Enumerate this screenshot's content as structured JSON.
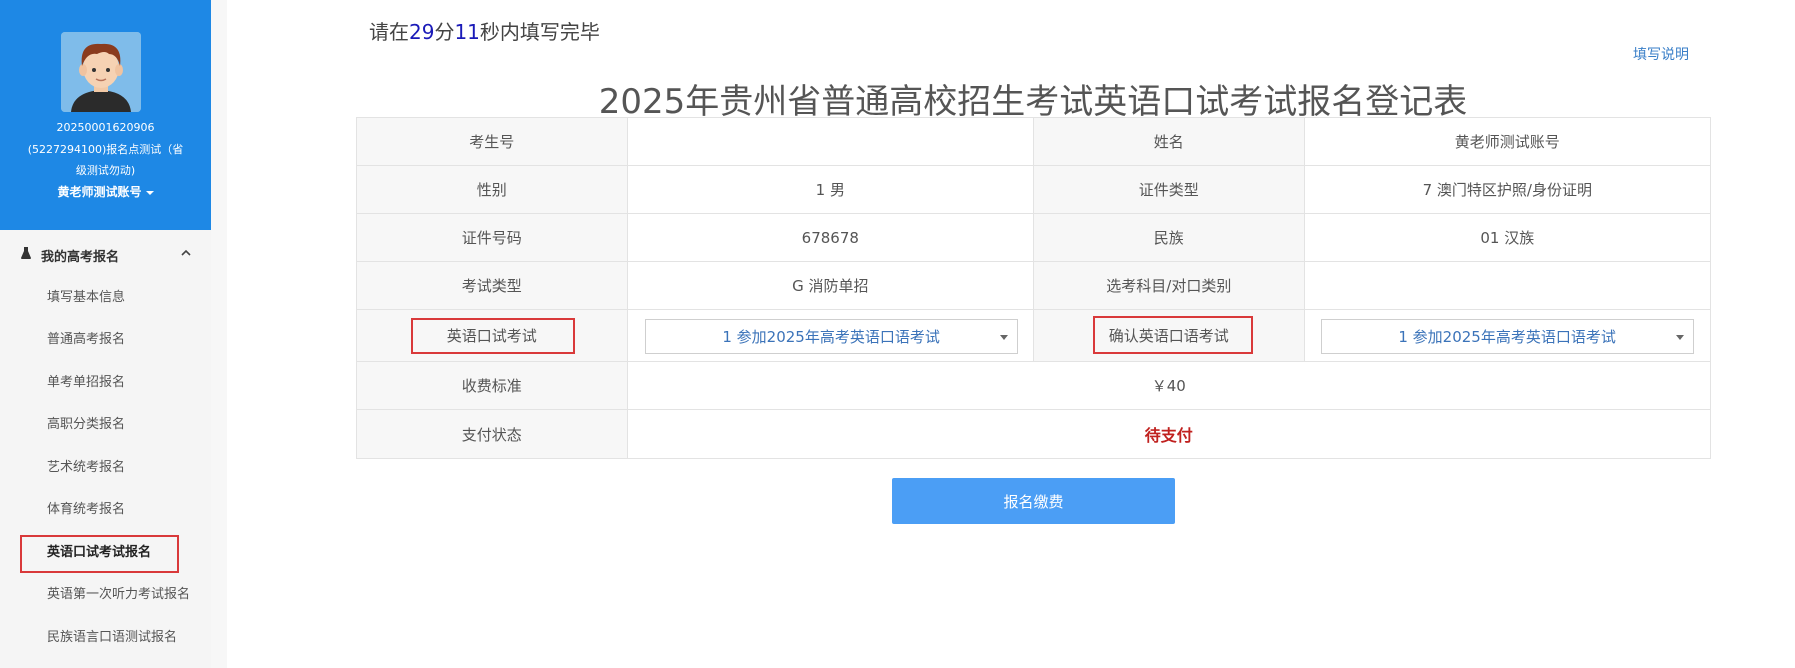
{
  "profile": {
    "id_line": "20250001620906",
    "site_line1": "(5227294100)报名点测试（省",
    "site_line2": "级测试勿动)",
    "user_name": "黄老师测试账号"
  },
  "sidebar": {
    "section_title": "我的高考报名",
    "items": [
      {
        "label": "填写基本信息"
      },
      {
        "label": "普通高考报名"
      },
      {
        "label": "单考单招报名"
      },
      {
        "label": "高职分类报名"
      },
      {
        "label": "艺术统考报名"
      },
      {
        "label": "体育统考报名"
      },
      {
        "label": "英语口试考试报名"
      },
      {
        "label": "英语第一次听力考试报名"
      },
      {
        "label": "民族语言口语测试报名"
      }
    ],
    "active_index": 6
  },
  "timer": {
    "prefix": "请在",
    "minutes": "29",
    "minutes_unit": "分",
    "seconds": "11",
    "suffix": "秒内填写完毕"
  },
  "help_link": "填写说明",
  "form": {
    "title": "2025年贵州省普通高校招生考试英语口试考试报名登记表",
    "rows": {
      "exam_no": {
        "label": "考生号",
        "value": ""
      },
      "name": {
        "label": "姓名",
        "value": "黄老师测试账号"
      },
      "gender": {
        "label": "性别",
        "value": "1 男"
      },
      "id_type": {
        "label": "证件类型",
        "value": "7 澳门特区护照/身份证明"
      },
      "id_no": {
        "label": "证件号码",
        "value": "678678"
      },
      "ethnicity": {
        "label": "民族",
        "value": "01 汉族"
      },
      "exam_type": {
        "label": "考试类型",
        "value": "G 消防单招"
      },
      "subject": {
        "label": "选考科目/对口类别",
        "value": ""
      },
      "oral_exam": {
        "label": "英语口试考试",
        "selected": "1 参加2025年高考英语口语考试"
      },
      "confirm_oral": {
        "label": "确认英语口语考试",
        "selected": "1 参加2025年高考英语口语考试"
      },
      "fee": {
        "label": "收费标准",
        "value": "￥40"
      },
      "payment": {
        "label": "支付状态",
        "value": "待支付"
      }
    },
    "submit_label": "报名缴费"
  },
  "colors": {
    "profile_bg": "#1e88e5",
    "highlight_box": "#d9393a",
    "button_bg": "#4b9ef5",
    "unpaid": "#c0211f",
    "timer_number": "#1a1ab8",
    "select_text": "#3b73b9"
  },
  "icons": {
    "menu_section": "flask-icon",
    "menu_toggle": "chevron-up-icon",
    "user_menu": "caret-down-icon",
    "select_arrow": "caret-down-icon"
  }
}
